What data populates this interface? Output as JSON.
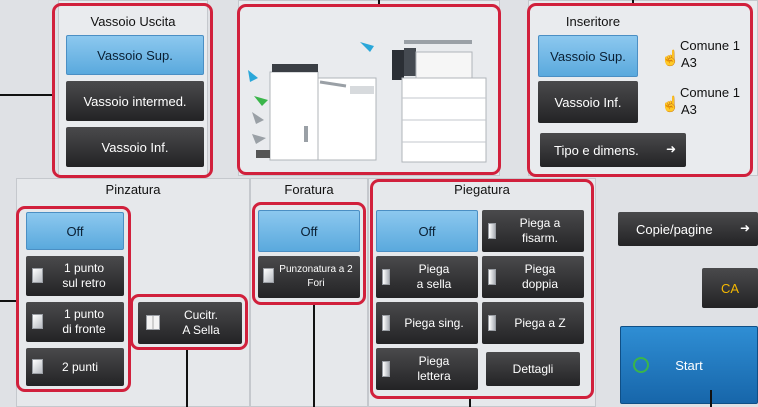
{
  "output_tray": {
    "title": "Vassoio Uscita",
    "upper": "Vassoio Sup.",
    "middle": "Vassoio intermed.",
    "lower": "Vassoio Inf."
  },
  "inserter": {
    "title": "Inseritore",
    "upper": "Vassoio Sup.",
    "lower": "Vassoio Inf.",
    "paper_type": "Comune 1",
    "paper_size": "A3",
    "type_size_button": "Tipo e dimens."
  },
  "stapling": {
    "title": "Pinzatura",
    "off": "Off",
    "one_back": "1 punto\nsul retro",
    "one_front": "1 punto\ndi fronte",
    "two": "2 punti",
    "saddle": "Cucitr.\nA Sella"
  },
  "punch": {
    "title": "Foratura",
    "off": "Off",
    "two_holes": "Punzonatura a 2\nFori"
  },
  "fold": {
    "title": "Piegatura",
    "off": "Off",
    "gate": "Piega a\nfisarm.",
    "saddle": "Piega\na sella",
    "double": "Piega\ndoppia",
    "single": "Piega sing.",
    "z": "Piega a Z",
    "letter": "Piega\nlettera",
    "details": "Dettagli"
  },
  "right": {
    "copies_pages": "Copie/pagine",
    "ca": "CA",
    "start": "Start"
  },
  "colors": {
    "selected": "#5aa9dd",
    "dark_button": "#2e2e30",
    "ca_button": "#f5b800",
    "start_button": "#1f7dc4",
    "callout": "#d1203c"
  },
  "icons": {
    "arrow": "right-arrow-icon",
    "hand": "hand-pointer-icon",
    "start": "start-diamond-icon"
  }
}
